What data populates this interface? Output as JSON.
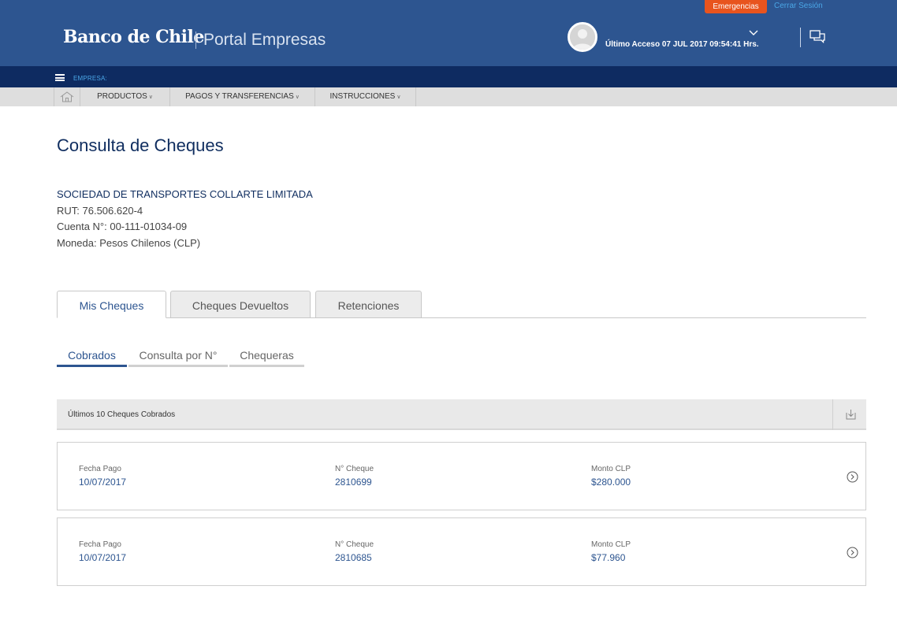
{
  "header": {
    "emergency_label": "Emergencias",
    "logout_label": "Cerrar Sesión",
    "brand_name": "Banco de Chile",
    "portal_name": "Portal Empresas",
    "last_access": "Último Acceso 07 JUL 2017 09:54:41 Hrs.",
    "icons": [
      "avatar-icon",
      "chevron-down-icon",
      "chat-icon"
    ]
  },
  "company_bar": {
    "label": "EMPRESA:"
  },
  "nav": {
    "home_icon": "home-icon",
    "items": [
      {
        "label": "PRODUCTOS"
      },
      {
        "label": "PAGOS Y TRANSFERENCIAS"
      },
      {
        "label": "INSTRUCCIONES"
      }
    ]
  },
  "page": {
    "title": "Consulta de Cheques",
    "company_name": "SOCIEDAD DE TRANSPORTES COLLARTE LIMITADA",
    "rut": "RUT: 76.506.620-4",
    "cuenta": "Cuenta N°: 00-111-01034-09",
    "moneda": "Moneda: Pesos Chilenos (CLP)"
  },
  "tabs": [
    {
      "label": "Mis Cheques",
      "active": true
    },
    {
      "label": "Cheques Devueltos",
      "active": false
    },
    {
      "label": "Retenciones",
      "active": false
    }
  ],
  "subtabs": [
    {
      "label": "Cobrados",
      "active": true
    },
    {
      "label": "Consulta por N°",
      "active": false
    },
    {
      "label": "Chequeras",
      "active": false
    }
  ],
  "list": {
    "title": "Últimos 10 Cheques Cobrados",
    "download_icon": "download-icon",
    "columns": [
      "Fecha Pago",
      "N° Cheque",
      "Monto CLP"
    ],
    "rows": [
      {
        "fecha": "10/07/2017",
        "numero": "2810699",
        "monto": "$280.000"
      },
      {
        "fecha": "10/07/2017",
        "numero": "2810685",
        "monto": "$77.960"
      }
    ]
  },
  "colors": {
    "header_bg": "#2d5590",
    "company_bar_bg": "#0e2b61",
    "emergency_bg": "#e8541e",
    "accent": "#2d5590",
    "link": "#4aa6e6"
  }
}
